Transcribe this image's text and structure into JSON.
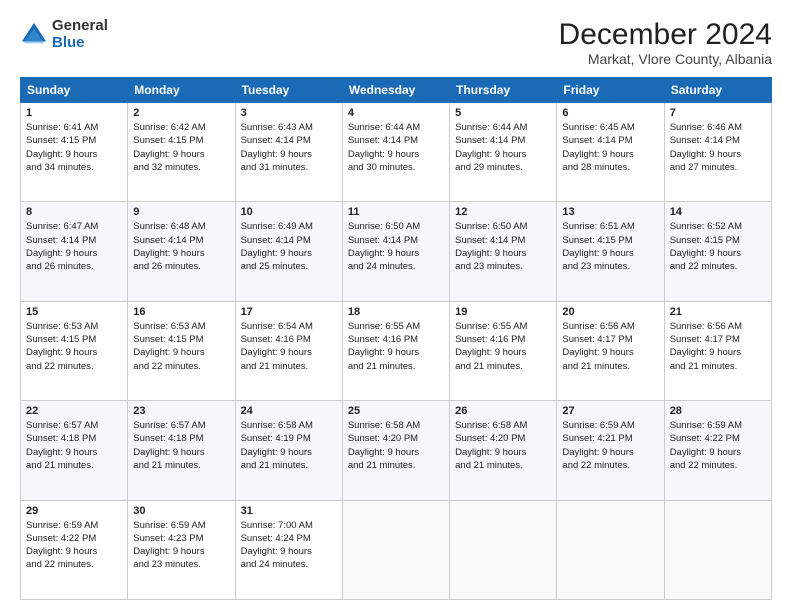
{
  "logo": {
    "general": "General",
    "blue": "Blue"
  },
  "header": {
    "title": "December 2024",
    "subtitle": "Markat, Vlore County, Albania"
  },
  "days_of_week": [
    "Sunday",
    "Monday",
    "Tuesday",
    "Wednesday",
    "Thursday",
    "Friday",
    "Saturday"
  ],
  "weeks": [
    [
      {
        "day": "1",
        "lines": [
          "Sunrise: 6:41 AM",
          "Sunset: 4:15 PM",
          "Daylight: 9 hours",
          "and 34 minutes."
        ]
      },
      {
        "day": "2",
        "lines": [
          "Sunrise: 6:42 AM",
          "Sunset: 4:15 PM",
          "Daylight: 9 hours",
          "and 32 minutes."
        ]
      },
      {
        "day": "3",
        "lines": [
          "Sunrise: 6:43 AM",
          "Sunset: 4:14 PM",
          "Daylight: 9 hours",
          "and 31 minutes."
        ]
      },
      {
        "day": "4",
        "lines": [
          "Sunrise: 6:44 AM",
          "Sunset: 4:14 PM",
          "Daylight: 9 hours",
          "and 30 minutes."
        ]
      },
      {
        "day": "5",
        "lines": [
          "Sunrise: 6:44 AM",
          "Sunset: 4:14 PM",
          "Daylight: 9 hours",
          "and 29 minutes."
        ]
      },
      {
        "day": "6",
        "lines": [
          "Sunrise: 6:45 AM",
          "Sunset: 4:14 PM",
          "Daylight: 9 hours",
          "and 28 minutes."
        ]
      },
      {
        "day": "7",
        "lines": [
          "Sunrise: 6:46 AM",
          "Sunset: 4:14 PM",
          "Daylight: 9 hours",
          "and 27 minutes."
        ]
      }
    ],
    [
      {
        "day": "8",
        "lines": [
          "Sunrise: 6:47 AM",
          "Sunset: 4:14 PM",
          "Daylight: 9 hours",
          "and 26 minutes."
        ]
      },
      {
        "day": "9",
        "lines": [
          "Sunrise: 6:48 AM",
          "Sunset: 4:14 PM",
          "Daylight: 9 hours",
          "and 26 minutes."
        ]
      },
      {
        "day": "10",
        "lines": [
          "Sunrise: 6:49 AM",
          "Sunset: 4:14 PM",
          "Daylight: 9 hours",
          "and 25 minutes."
        ]
      },
      {
        "day": "11",
        "lines": [
          "Sunrise: 6:50 AM",
          "Sunset: 4:14 PM",
          "Daylight: 9 hours",
          "and 24 minutes."
        ]
      },
      {
        "day": "12",
        "lines": [
          "Sunrise: 6:50 AM",
          "Sunset: 4:14 PM",
          "Daylight: 9 hours",
          "and 23 minutes."
        ]
      },
      {
        "day": "13",
        "lines": [
          "Sunrise: 6:51 AM",
          "Sunset: 4:15 PM",
          "Daylight: 9 hours",
          "and 23 minutes."
        ]
      },
      {
        "day": "14",
        "lines": [
          "Sunrise: 6:52 AM",
          "Sunset: 4:15 PM",
          "Daylight: 9 hours",
          "and 22 minutes."
        ]
      }
    ],
    [
      {
        "day": "15",
        "lines": [
          "Sunrise: 6:53 AM",
          "Sunset: 4:15 PM",
          "Daylight: 9 hours",
          "and 22 minutes."
        ]
      },
      {
        "day": "16",
        "lines": [
          "Sunrise: 6:53 AM",
          "Sunset: 4:15 PM",
          "Daylight: 9 hours",
          "and 22 minutes."
        ]
      },
      {
        "day": "17",
        "lines": [
          "Sunrise: 6:54 AM",
          "Sunset: 4:16 PM",
          "Daylight: 9 hours",
          "and 21 minutes."
        ]
      },
      {
        "day": "18",
        "lines": [
          "Sunrise: 6:55 AM",
          "Sunset: 4:16 PM",
          "Daylight: 9 hours",
          "and 21 minutes."
        ]
      },
      {
        "day": "19",
        "lines": [
          "Sunrise: 6:55 AM",
          "Sunset: 4:16 PM",
          "Daylight: 9 hours",
          "and 21 minutes."
        ]
      },
      {
        "day": "20",
        "lines": [
          "Sunrise: 6:56 AM",
          "Sunset: 4:17 PM",
          "Daylight: 9 hours",
          "and 21 minutes."
        ]
      },
      {
        "day": "21",
        "lines": [
          "Sunrise: 6:56 AM",
          "Sunset: 4:17 PM",
          "Daylight: 9 hours",
          "and 21 minutes."
        ]
      }
    ],
    [
      {
        "day": "22",
        "lines": [
          "Sunrise: 6:57 AM",
          "Sunset: 4:18 PM",
          "Daylight: 9 hours",
          "and 21 minutes."
        ]
      },
      {
        "day": "23",
        "lines": [
          "Sunrise: 6:57 AM",
          "Sunset: 4:18 PM",
          "Daylight: 9 hours",
          "and 21 minutes."
        ]
      },
      {
        "day": "24",
        "lines": [
          "Sunrise: 6:58 AM",
          "Sunset: 4:19 PM",
          "Daylight: 9 hours",
          "and 21 minutes."
        ]
      },
      {
        "day": "25",
        "lines": [
          "Sunrise: 6:58 AM",
          "Sunset: 4:20 PM",
          "Daylight: 9 hours",
          "and 21 minutes."
        ]
      },
      {
        "day": "26",
        "lines": [
          "Sunrise: 6:58 AM",
          "Sunset: 4:20 PM",
          "Daylight: 9 hours",
          "and 21 minutes."
        ]
      },
      {
        "day": "27",
        "lines": [
          "Sunrise: 6:59 AM",
          "Sunset: 4:21 PM",
          "Daylight: 9 hours",
          "and 22 minutes."
        ]
      },
      {
        "day": "28",
        "lines": [
          "Sunrise: 6:59 AM",
          "Sunset: 4:22 PM",
          "Daylight: 9 hours",
          "and 22 minutes."
        ]
      }
    ],
    [
      {
        "day": "29",
        "lines": [
          "Sunrise: 6:59 AM",
          "Sunset: 4:22 PM",
          "Daylight: 9 hours",
          "and 22 minutes."
        ]
      },
      {
        "day": "30",
        "lines": [
          "Sunrise: 6:59 AM",
          "Sunset: 4:23 PM",
          "Daylight: 9 hours",
          "and 23 minutes."
        ]
      },
      {
        "day": "31",
        "lines": [
          "Sunrise: 7:00 AM",
          "Sunset: 4:24 PM",
          "Daylight: 9 hours",
          "and 24 minutes."
        ]
      },
      null,
      null,
      null,
      null
    ]
  ]
}
